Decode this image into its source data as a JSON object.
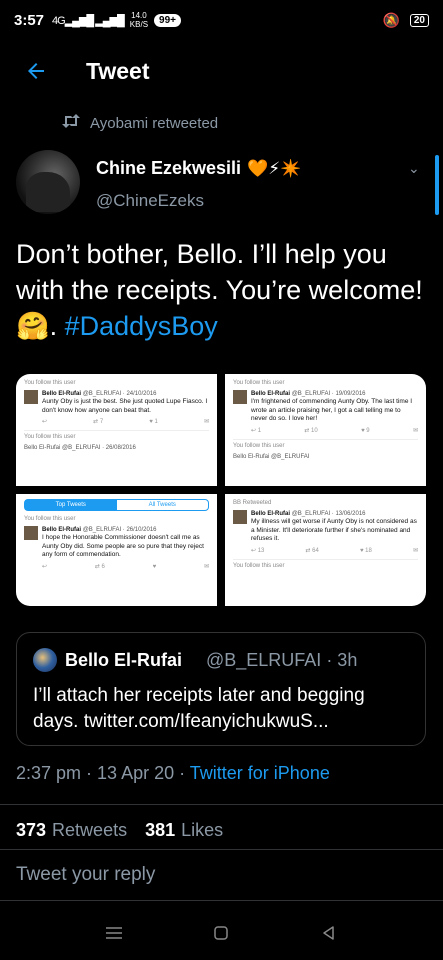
{
  "status": {
    "time": "3:57",
    "signal": "4G",
    "speed_value": "14.0",
    "speed_unit": "KB/S",
    "notif_badge": "99+",
    "battery": "20"
  },
  "header": {
    "title": "Tweet"
  },
  "retweet_line": "Ayobami retweeted",
  "author": {
    "name": "Chine Ezekwesili",
    "emojis": "🧡⚡✴️",
    "handle": "@ChineEzeks"
  },
  "tweet": {
    "text": "Don’t bother, Bello. I’ll help you with the receipts. You’re welcome! 🤗. ",
    "hashtag": "#DaddysBoy"
  },
  "media": [
    {
      "follow": "You follow this user",
      "head_name": "Bello El-Rufai",
      "head_meta": "@B_ELRUFAI · 24/10/2016",
      "body": "Aunty Oby is just the best. She just quoted Lupe Fiasco. I don't know how anyone can beat that.",
      "actions": [
        "↩",
        "⇄ 7",
        "♥ 1",
        "✉"
      ],
      "follow2": "You follow this user",
      "head2": "Bello El-Rufai @B_ELRUFAI · 26/08/2016"
    },
    {
      "follow": "You follow this user",
      "head_name": "Bello El-Rufai",
      "head_meta": "@B_ELRUFAI · 19/09/2016",
      "body": "I'm frightened of commending Aunty Oby. The last time I wrote an article praising her, I got a call telling me to never do so. I love her!",
      "actions": [
        "↩ 1",
        "⇄ 10",
        "♥ 9",
        "✉"
      ],
      "follow2": "You follow this user",
      "head2": "Bello El-Rufai @B_ELRUFAI"
    },
    {
      "tabs": [
        "Top Tweets",
        "All Tweets"
      ],
      "follow": "You follow this user",
      "head_name": "Bello El-Rufai",
      "head_meta": "@B_ELRUFAI · 26/10/2016",
      "body": "I hope the Honorable Commissioner doesn't call me as Aunty Oby did. Some people are so pure that they reject any form of commendation.",
      "actions": [
        "↩",
        "⇄ 6",
        "♥",
        "✉"
      ]
    },
    {
      "follow": "BB Retweeted",
      "head_name": "Bello El-Rufai",
      "head_meta": "@B_ELRUFAI · 13/06/2016",
      "body": "My illness will get worse if Aunty Oby is not considered as a Minister. It'll deteriorate further if she's nominated and refuses it.",
      "actions": [
        "↩ 13",
        "⇄ 64",
        "♥ 18",
        "✉"
      ],
      "follow2": "You follow this user"
    }
  ],
  "quote": {
    "name": "Bello El-Rufai",
    "handle": "@B_ELRUFAI · 3h",
    "text": "I’ll attach her receipts later and begging days. twitter.com/IfeanyichukwuS..."
  },
  "meta": {
    "time": "2:37 pm · 13 Apr 20 · ",
    "source": "Twitter for iPhone"
  },
  "stats": {
    "retweets_count": "373",
    "retweets_label": "Retweets",
    "likes_count": "381",
    "likes_label": "Likes"
  },
  "reply_placeholder": "Tweet your reply",
  "colors": {
    "accent": "#1d9bf0",
    "muted": "#8b98a5",
    "background": "#000000"
  }
}
